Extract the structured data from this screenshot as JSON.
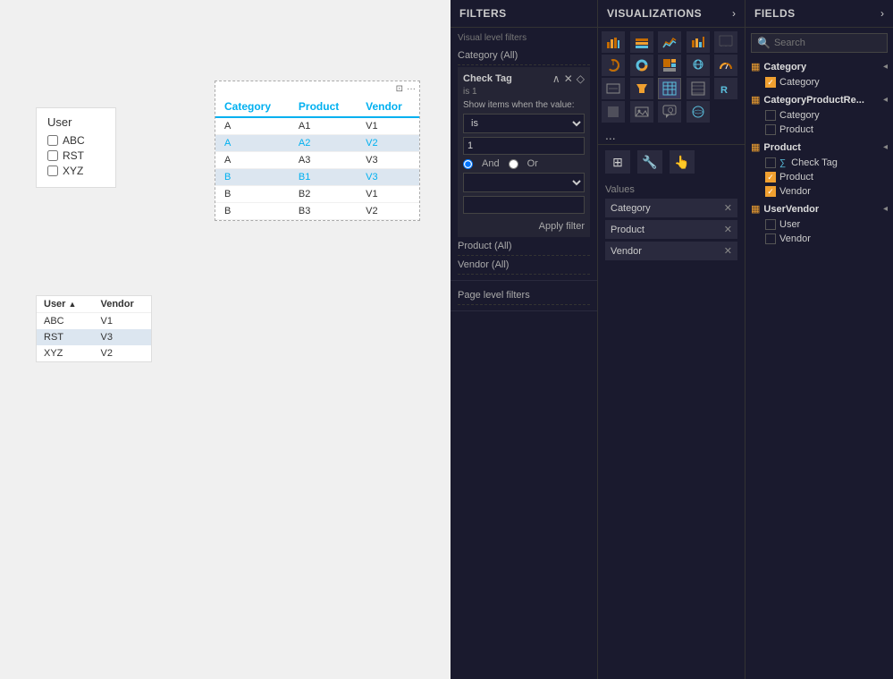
{
  "canvas": {
    "userSlicer": {
      "title": "User",
      "items": [
        {
          "label": "ABC",
          "checked": false
        },
        {
          "label": "RST",
          "checked": false
        },
        {
          "label": "XYZ",
          "checked": false
        }
      ]
    },
    "userVendorTable": {
      "columns": [
        "User",
        "Vendor"
      ],
      "rows": [
        {
          "user": "ABC",
          "vendor": "V1",
          "highlight": false
        },
        {
          "user": "RST",
          "vendor": "V3",
          "highlight": true
        },
        {
          "user": "XYZ",
          "vendor": "V2",
          "highlight": false
        }
      ]
    },
    "dataTable": {
      "columns": [
        "Category",
        "Product",
        "Vendor"
      ],
      "rows": [
        {
          "category": "A",
          "product": "A1",
          "vendor": "V1",
          "highlight": false
        },
        {
          "category": "A",
          "product": "A2",
          "vendor": "V2",
          "highlight": true
        },
        {
          "category": "A",
          "product": "A3",
          "vendor": "V3",
          "highlight": false
        },
        {
          "category": "B",
          "product": "B1",
          "vendor": "V3",
          "highlight": true
        },
        {
          "category": "B",
          "product": "B2",
          "vendor": "V1",
          "highlight": false
        },
        {
          "category": "B",
          "product": "B3",
          "vendor": "V2",
          "highlight": false
        }
      ]
    }
  },
  "visualizations": {
    "title": "VISUALIZATIONS",
    "arrow": "›",
    "tools": [
      "⊞",
      "🔧",
      "👆"
    ],
    "values_label": "Values",
    "values": [
      {
        "label": "Category"
      },
      {
        "label": "Product"
      },
      {
        "label": "Vendor"
      }
    ]
  },
  "filters": {
    "title": "FILTERS",
    "visual_level_label": "Visual level filters",
    "items": [
      {
        "label": "Category (All)",
        "expanded": false
      },
      {
        "label": "Check Tag",
        "expanded": true,
        "subtitle": "is 1",
        "description": "Show items when the value:",
        "condition_select": "is",
        "condition_value": "1",
        "radio_and": "And",
        "radio_or": "Or",
        "radio_selected": "and",
        "second_select": "",
        "second_value": "",
        "apply_label": "Apply filter"
      },
      {
        "label": "Product (All)",
        "expanded": false
      },
      {
        "label": "Vendor (All)",
        "expanded": false
      },
      {
        "label": "Page level filters",
        "expanded": false
      }
    ]
  },
  "fields": {
    "title": "FIELDS",
    "arrow": "›",
    "search_placeholder": "Search",
    "groups": [
      {
        "name": "Category",
        "icon": "table",
        "items": [
          {
            "name": "Category",
            "checked": true,
            "type": "field"
          }
        ]
      },
      {
        "name": "CategoryProductRe...",
        "icon": "table",
        "items": [
          {
            "name": "Category",
            "checked": false,
            "type": "field"
          },
          {
            "name": "Product",
            "checked": false,
            "type": "field"
          }
        ]
      },
      {
        "name": "Product",
        "icon": "table",
        "items": [
          {
            "name": "Check Tag",
            "checked": false,
            "type": "sigma"
          },
          {
            "name": "Product",
            "checked": true,
            "type": "field"
          },
          {
            "name": "Vendor",
            "checked": true,
            "type": "field"
          }
        ]
      },
      {
        "name": "UserVendor",
        "icon": "table",
        "items": [
          {
            "name": "User",
            "checked": false,
            "type": "field"
          },
          {
            "name": "Vendor",
            "checked": false,
            "type": "field"
          }
        ]
      }
    ]
  }
}
